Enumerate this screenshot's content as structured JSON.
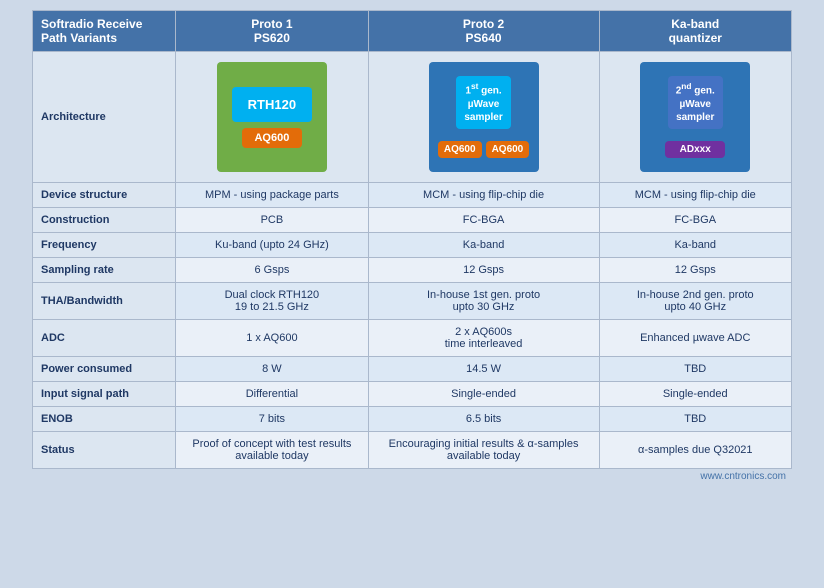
{
  "header": {
    "title": "Softradio Receive Path Variants",
    "col1": "Proto 1\nPS620",
    "col2": "Proto 2\nPS640",
    "col3": "Ka-band quantizer"
  },
  "rows": [
    {
      "label": "Device structure",
      "col1": "MPM - using package parts",
      "col2": "MCM - using flip-chip die",
      "col3": "MCM - using flip-chip die"
    },
    {
      "label": "Construction",
      "col1": "PCB",
      "col2": "FC-BGA",
      "col3": "FC-BGA"
    },
    {
      "label": "Frequency",
      "col1": "Ku-band (upto 24 GHz)",
      "col2": "Ka-band",
      "col3": "Ka-band"
    },
    {
      "label": "Sampling rate",
      "col1": "6 Gsps",
      "col2": "12 Gsps",
      "col3": "12 Gsps"
    },
    {
      "label": "THA/Bandwidth",
      "col1": "Dual clock RTH120\n19 to 21.5 GHz",
      "col2": "In-house 1st gen. proto\nupto 30 GHz",
      "col3": "In-house 2nd gen. proto\nupto 40 GHz"
    },
    {
      "label": "ADC",
      "col1": "1 x AQ600",
      "col2": "2 x AQ600s\ntime interleaved",
      "col3": "Enhanced µwave ADC"
    },
    {
      "label": "Power consumed",
      "col1": "8 W",
      "col2": "14.5 W",
      "col3": "TBD"
    },
    {
      "label": "Input signal path",
      "col1": "Differential",
      "col2": "Single-ended",
      "col3": "Single-ended"
    },
    {
      "label": "ENOB",
      "col1": "7 bits",
      "col2": "6.5 bits",
      "col3": "TBD"
    },
    {
      "label": "Status",
      "col1": "Proof of concept with test results available today",
      "col2": "Encouraging initial results & α-samples available today",
      "col3": "α-samples due Q32021"
    }
  ],
  "arch_label": "Architecture",
  "watermark": "www.cntronics.com"
}
